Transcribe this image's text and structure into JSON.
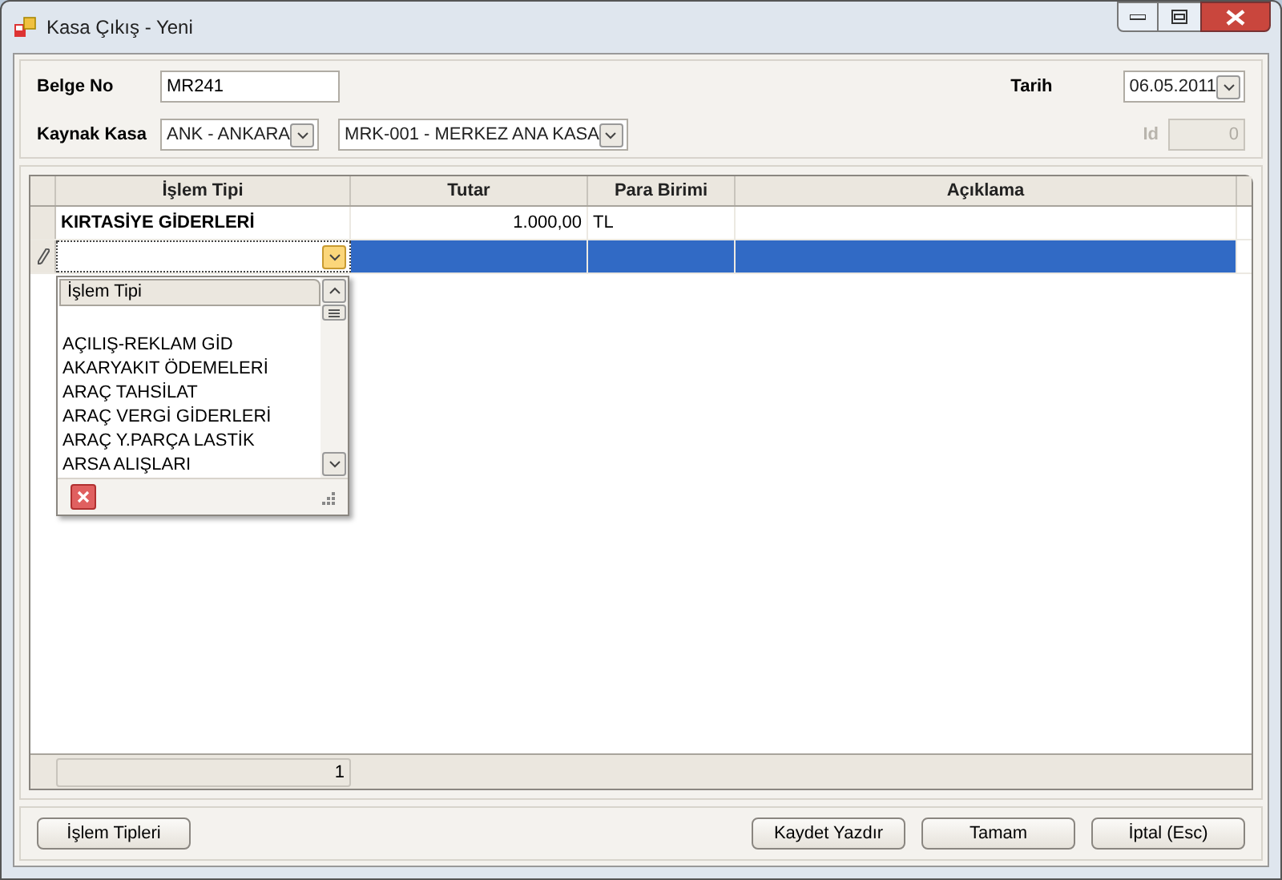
{
  "window": {
    "title": "Kasa Çıkış - Yeni"
  },
  "form": {
    "belge_no": {
      "label": "Belge No",
      "value": "MR241"
    },
    "tarih": {
      "label": "Tarih",
      "value": "06.05.2011"
    },
    "kaynak_kasa": {
      "label": "Kaynak Kasa",
      "value": "ANK - ANKARA",
      "value_2": "MRK-001 - MERKEZ ANA KASA"
    },
    "id": {
      "label": "Id",
      "value": "0",
      "disabled": true
    }
  },
  "table": {
    "columns": [
      "İşlem Tipi",
      "Tutar",
      "Para Birimi",
      "Açıklama"
    ],
    "rows": [
      {
        "cells": [
          "KIRTASİYE GİDERLERİ",
          "1.000,00",
          "TL",
          ""
        ],
        "selected": false,
        "editing": false
      },
      {
        "cells": [
          "",
          "",
          "",
          ""
        ],
        "selected": true,
        "editing": true
      }
    ],
    "footer": {
      "count": "1"
    }
  },
  "dropdown": {
    "header": "İşlem Tipi",
    "items": [
      "AÇILIŞ-REKLAM GİD",
      "AKARYAKIT ÖDEMELERİ",
      "ARAÇ TAHSİLAT",
      "ARAÇ VERGİ GİDERLERİ",
      "ARAÇ Y.PARÇA LASTİK",
      "ARSA ALIŞLARI"
    ]
  },
  "buttons": {
    "left": "İşlem Tipleri",
    "right": [
      "Kaydet Yazdır",
      "Tamam",
      "İptal (Esc)"
    ]
  }
}
